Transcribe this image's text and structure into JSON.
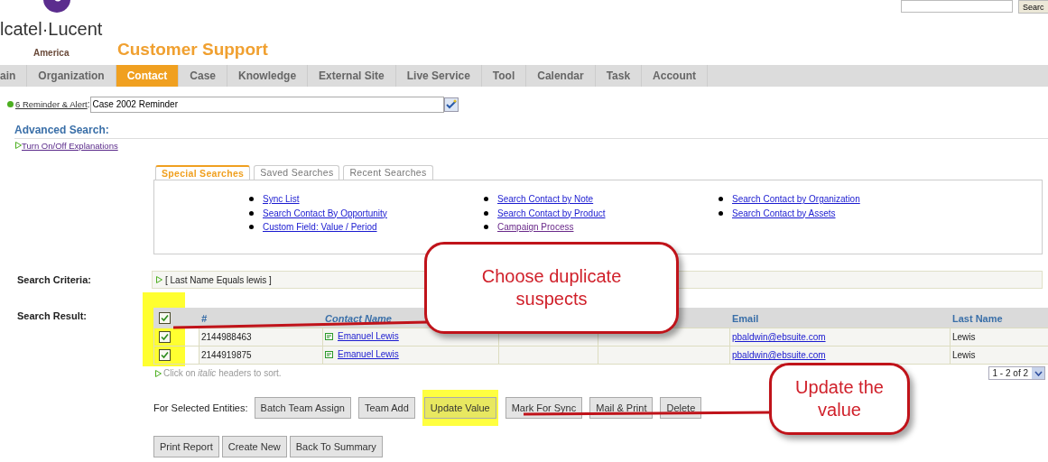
{
  "header": {
    "logo_text": "lcatel·Lucent",
    "logo_subtext": "America",
    "title": "Customer Support",
    "search_button": "Searc"
  },
  "nav_tabs": [
    {
      "label": "ain",
      "selected": false
    },
    {
      "label": "Organization",
      "selected": false
    },
    {
      "label": "Contact",
      "selected": true
    },
    {
      "label": "Case",
      "selected": false
    },
    {
      "label": "Knowledge",
      "selected": false
    },
    {
      "label": "External Site",
      "selected": false
    },
    {
      "label": "Live Service",
      "selected": false
    },
    {
      "label": "Tool",
      "selected": false
    },
    {
      "label": "Calendar",
      "selected": false
    },
    {
      "label": "Task",
      "selected": false
    },
    {
      "label": "Account",
      "selected": false
    }
  ],
  "reminder": {
    "link": "6 Reminder & Alert",
    "separator": ":",
    "value": "Case 2002 Reminder"
  },
  "advanced_search": {
    "title": "Advanced Search:",
    "toggle_link": "Turn On/Off Explanations"
  },
  "search_tabs": [
    {
      "label": "Special Searches",
      "selected": true
    },
    {
      "label": "Saved Searches",
      "selected": false
    },
    {
      "label": "Recent Searches",
      "selected": false
    }
  ],
  "special_searches": [
    [
      {
        "label": "Sync List",
        "visited": false
      },
      {
        "label": "Search Contact By Opportunity",
        "visited": false
      },
      {
        "label": "Custom Field: Value / Period",
        "visited": false
      }
    ],
    [
      {
        "label": "Search Contact by Note",
        "visited": false
      },
      {
        "label": "Search Contact by Product",
        "visited": false
      },
      {
        "label": "Campaign Process",
        "visited": true
      }
    ],
    [
      {
        "label": "Search Contact by Organization",
        "visited": false
      },
      {
        "label": "Search Contact by Assets",
        "visited": false
      }
    ]
  ],
  "search_criteria": {
    "label": "Search Criteria:",
    "value": "[ Last Name Equals lewis ]"
  },
  "search_result": {
    "label": "Search Result:",
    "header_checked": true,
    "highlighted": true,
    "columns": [
      {
        "kind": "text",
        "label": "#",
        "sortable": true
      },
      {
        "kind": "contact",
        "label": "Contact Name",
        "sortable": true
      },
      {
        "kind": "blank"
      },
      {
        "kind": "blank"
      },
      {
        "kind": "email",
        "label": "Email",
        "sortable": false
      },
      {
        "kind": "text",
        "label": "Last Name",
        "sortable": false
      }
    ],
    "rows": [
      {
        "checked": true,
        "cells": [
          "2144988463",
          "Emanuel Lewis",
          null,
          null,
          "pbaldwin@ebsuite.com",
          "Lewis"
        ]
      },
      {
        "checked": true,
        "cells": [
          "2144919875",
          "Emanuel Lewis",
          null,
          null,
          "pbaldwin@ebsuite.com",
          "Lewis"
        ]
      }
    ],
    "sort_hint": "Click on *italic* headers to sort.",
    "pager": "1 - 2 of 2"
  },
  "actions": {
    "label": "For Selected Entities:",
    "buttons": [
      {
        "label": "Batch Team Assign",
        "highlighted": false
      },
      {
        "label": "Team Add",
        "highlighted": false
      },
      {
        "label": "Update Value",
        "highlighted": true
      },
      {
        "label": "Mark For Sync",
        "highlighted": false
      },
      {
        "label": "Mail & Print",
        "highlighted": false
      },
      {
        "label": "Delete",
        "highlighted": false
      }
    ]
  },
  "bottom_buttons": [
    "Print Report",
    "Create New",
    "Back To Summary"
  ],
  "annotations": [
    {
      "kind": "callout",
      "text": "Choose duplicate suspects"
    },
    {
      "kind": "callout",
      "text": "Update the value"
    }
  ]
}
